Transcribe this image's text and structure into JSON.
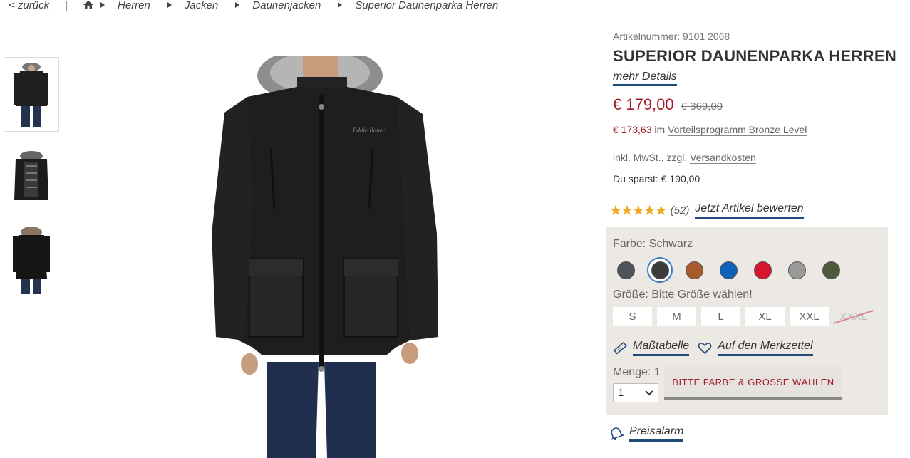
{
  "breadcrumb": {
    "back": "< zurück",
    "separator": "|",
    "items": [
      "Herren",
      "Jacken",
      "Daunenjacken",
      "Superior Daunenparka Herren"
    ]
  },
  "product": {
    "article_number": "Artikelnummer: 9101 2068",
    "title": "SUPERIOR DAUNENPARKA HERREN",
    "more_details": "mehr Details",
    "price": "€ 179,00",
    "old_price": "€ 369,00",
    "loyalty_price": "€ 173,63",
    "loyalty_in": "im",
    "loyalty_program": "Vorteilsprogramm Bronze Level",
    "tax_prefix": "inkl. MwSt., zzgl.",
    "shipping_link": "Versandkosten",
    "savings": "Du sparst: € 190,00",
    "rating_stars": "★★★★★",
    "rating_value": 5,
    "rating_count": "(52)",
    "rate_link": "Jetzt Artikel bewerten"
  },
  "options": {
    "color_label": "Farbe: Schwarz",
    "colors": [
      {
        "name": "grau-dunkel",
        "hex": "#4f545a",
        "selected": false
      },
      {
        "name": "schwarz",
        "hex": "#3b3b3b",
        "selected": true
      },
      {
        "name": "braun",
        "hex": "#a85a2c",
        "selected": false
      },
      {
        "name": "blau",
        "hex": "#0f62b8",
        "selected": false
      },
      {
        "name": "rot",
        "hex": "#d8152e",
        "selected": false
      },
      {
        "name": "grau-hell",
        "hex": "#9a9a9a",
        "selected": false
      },
      {
        "name": "oliv",
        "hex": "#4d5a3c",
        "selected": false
      }
    ],
    "size_label": "Größe: Bitte Größe wählen!",
    "sizes": [
      {
        "label": "S",
        "available": true
      },
      {
        "label": "M",
        "available": true
      },
      {
        "label": "L",
        "available": true
      },
      {
        "label": "XL",
        "available": true
      },
      {
        "label": "XXL",
        "available": true
      },
      {
        "label": "XXXL",
        "available": false
      }
    ],
    "size_chart": "Maßtabelle",
    "wishlist": "Auf den Merkzettel",
    "qty_label": "Menge: 1",
    "qty_value": "1",
    "cta": "BITTE FARBE & GRÖSSE WÄHLEN"
  },
  "price_alarm": "Preisalarm",
  "colors": {
    "accent_blue": "#1e4a7a",
    "price_red": "#a41e2a",
    "star": "#f0a81c",
    "options_bg": "#ece9e5"
  }
}
